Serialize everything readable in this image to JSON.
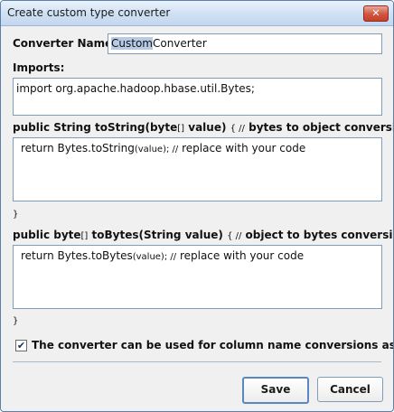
{
  "window": {
    "title": "Create custom type converter",
    "close_glyph": "✕"
  },
  "name_row": {
    "label": "Converter Name:",
    "value_selected": "Custom",
    "value_rest": "Converter"
  },
  "imports": {
    "label": "Imports:",
    "code": "import org.apache.hadoop.hbase.util.Bytes;"
  },
  "to_string": {
    "signature_part1": "public String toString(byte",
    "brackets": "[]",
    "signature_part2": " value) ",
    "brace_comment": "{ //",
    "comment": " bytes to object conversion",
    "code_part1": "return Bytes.toString",
    "code_args": "(value); //",
    "code_comment": " replace with your code",
    "closing": "}"
  },
  "to_bytes": {
    "signature_part1": "public byte",
    "brackets": "[]",
    "signature_part2": " toBytes(String value) ",
    "brace_comment": "{ //",
    "comment": " object to bytes conversion",
    "code_part1": "return Bytes.toBytes",
    "code_args": "(value); //",
    "code_comment": " replace with your code",
    "closing": "}"
  },
  "column_option": {
    "checked": true,
    "check_glyph": "✔",
    "label": "The converter can be used for column name conversions as well."
  },
  "buttons": {
    "save": "Save",
    "cancel": "Cancel"
  }
}
